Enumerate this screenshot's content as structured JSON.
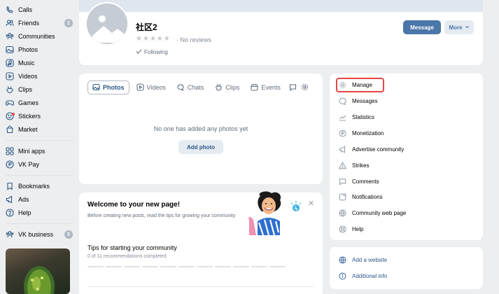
{
  "sidebar": {
    "items": [
      {
        "label": "Calls",
        "badge": null
      },
      {
        "label": "Friends",
        "badge": "2"
      },
      {
        "label": "Communities",
        "badge": null
      },
      {
        "label": "Photos",
        "badge": null
      },
      {
        "label": "Music",
        "badge": null
      },
      {
        "label": "Videos",
        "badge": null
      },
      {
        "label": "Clips",
        "badge": null
      },
      {
        "label": "Games",
        "badge": null
      },
      {
        "label": "Stickers",
        "badge": null
      },
      {
        "label": "Market",
        "badge": null
      },
      {
        "label": "Mini apps",
        "badge": null
      },
      {
        "label": "VK Pay",
        "badge": null
      },
      {
        "label": "Bookmarks",
        "badge": null
      },
      {
        "label": "Ads",
        "badge": null
      },
      {
        "label": "Help",
        "badge": null
      },
      {
        "label": "VK business",
        "badge": "5"
      }
    ]
  },
  "profile": {
    "name": "社区2",
    "reviews": "· No reviews",
    "following": "Following",
    "message_button": "Message",
    "more_button": "More"
  },
  "media": {
    "tabs": [
      "Photos",
      "Videos",
      "Chats",
      "Clips",
      "Events"
    ],
    "empty_text": "No one has added any photos yet",
    "add_button": "Add photo"
  },
  "welcome": {
    "title": "Welcome to your new page!",
    "description": "Before creating new posts, read the tips for growing your community",
    "tips_title": "Tips for starting your community",
    "tips_count": "0 of 11 recommendations completed",
    "tips_total": 11,
    "tips_completed": 0
  },
  "right_menu": {
    "items": [
      "Manage",
      "Messages",
      "Statistics",
      "Monetization",
      "Advertise community",
      "Strikes",
      "Comments",
      "Notifications",
      "Community web page",
      "Help"
    ],
    "links": [
      "Add a website",
      "Additional info"
    ]
  },
  "colors": {
    "accent": "#4a76a8",
    "highlight": "#e64646",
    "background": "#edeef0"
  }
}
